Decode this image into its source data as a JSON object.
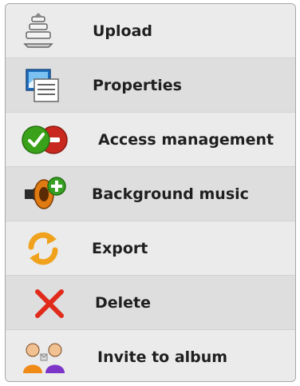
{
  "menu": {
    "items": [
      {
        "label": "Upload",
        "icon": "upload-icon"
      },
      {
        "label": "Properties",
        "icon": "properties-icon"
      },
      {
        "label": "Access management",
        "icon": "access-toggle-icon"
      },
      {
        "label": "Background music",
        "icon": "music-add-icon"
      },
      {
        "label": "Export",
        "icon": "export-refresh-icon"
      },
      {
        "label": "Delete",
        "icon": "delete-x-icon"
      },
      {
        "label": "Invite to album",
        "icon": "invite-users-icon"
      }
    ]
  },
  "colors": {
    "row_light": "#ebebeb",
    "row_dark": "#dedede",
    "text": "#1f1f1f",
    "delete_red": "#e02a1a",
    "access_green": "#3aa21a",
    "access_red": "#c8281e",
    "export_orange": "#f0a21c"
  }
}
